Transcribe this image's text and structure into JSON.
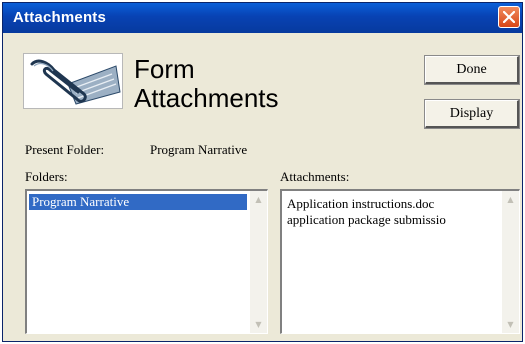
{
  "window": {
    "title": "Attachments"
  },
  "header": {
    "title_line1": "Form",
    "title_line2": "Attachments",
    "logo_icon": "paperclip-document-icon"
  },
  "toolbar": {
    "done_label": "Done",
    "display_label": "Display"
  },
  "present_folder": {
    "label": "Present Folder:",
    "value": "Program Narrative"
  },
  "folders": {
    "label": "Folders:",
    "items": [
      {
        "label": "Program Narrative",
        "selected": true
      }
    ]
  },
  "attachments": {
    "label": "Attachments:",
    "items": [
      {
        "label": "Application instructions.doc"
      },
      {
        "label": "application package submissio"
      }
    ]
  },
  "colors": {
    "titlebar": "#0842b3",
    "selection": "#316ac5",
    "window_bg": "#ece9d8",
    "close_button": "#d84617"
  }
}
